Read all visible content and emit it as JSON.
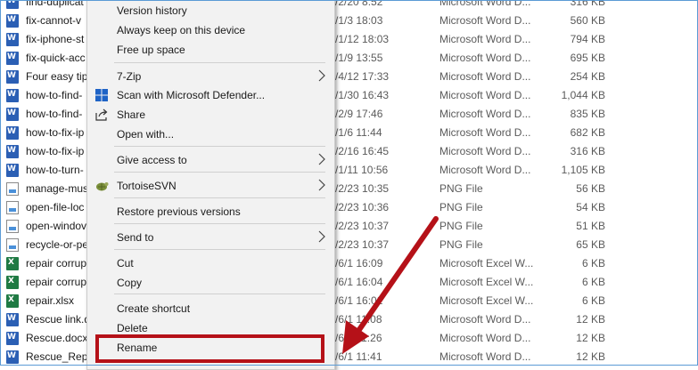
{
  "files": [
    {
      "name": "find-duplicat",
      "date": "/2/20 8:52",
      "type": "Microsoft Word D...",
      "size": "316 KB",
      "kind": "word"
    },
    {
      "name": "fix-cannot-v",
      "date": "/1/3 18:03",
      "type": "Microsoft Word D...",
      "size": "560 KB",
      "kind": "word"
    },
    {
      "name": "fix-iphone-st",
      "date": "/1/12 18:03",
      "type": "Microsoft Word D...",
      "size": "794 KB",
      "kind": "word"
    },
    {
      "name": "fix-quick-acc",
      "date": "/1/9 13:55",
      "type": "Microsoft Word D...",
      "size": "695 KB",
      "kind": "word"
    },
    {
      "name": "Four easy  tip",
      "date": "/4/12 17:33",
      "type": "Microsoft Word D...",
      "size": "254 KB",
      "kind": "word"
    },
    {
      "name": "how-to-find-",
      "date": "/1/30 16:43",
      "type": "Microsoft Word D...",
      "size": "1,044 KB",
      "kind": "word"
    },
    {
      "name": "how-to-find-",
      "date": "/2/9 17:46",
      "type": "Microsoft Word D...",
      "size": "835 KB",
      "kind": "word"
    },
    {
      "name": "how-to-fix-ip",
      "date": "/1/6 11:44",
      "type": "Microsoft Word D...",
      "size": "682 KB",
      "kind": "word"
    },
    {
      "name": "how-to-fix-ip",
      "date": "/2/16 16:45",
      "type": "Microsoft Word D...",
      "size": "316 KB",
      "kind": "word"
    },
    {
      "name": "how-to-turn-",
      "date": "/1/11 10:56",
      "type": "Microsoft Word D...",
      "size": "1,105 KB",
      "kind": "word"
    },
    {
      "name": "manage-mus",
      "date": "/2/23 10:35",
      "type": "PNG File",
      "size": "56 KB",
      "kind": "png"
    },
    {
      "name": "open-file-loc",
      "date": "/2/23 10:36",
      "type": "PNG File",
      "size": "54 KB",
      "kind": "png"
    },
    {
      "name": "open-windov",
      "date": "/2/23 10:37",
      "type": "PNG File",
      "size": "51 KB",
      "kind": "png"
    },
    {
      "name": "recycle-or-pe",
      "date": "/2/23 10:37",
      "type": "PNG File",
      "size": "65 KB",
      "kind": "png"
    },
    {
      "name": "repair corrup",
      "date": "/6/1 16:09",
      "type": "Microsoft Excel W...",
      "size": "6 KB",
      "kind": "excel"
    },
    {
      "name": "repair corrup",
      "date": "/6/1 16:04",
      "type": "Microsoft Excel W...",
      "size": "6 KB",
      "kind": "excel"
    },
    {
      "name": "repair.xlsx",
      "date": "/6/1 16:02",
      "type": "Microsoft Excel W...",
      "size": "6 KB",
      "kind": "excel"
    },
    {
      "name": "Rescue link.d",
      "date": "/6/1 11:08",
      "type": "Microsoft Word D...",
      "size": "12 KB",
      "kind": "word"
    },
    {
      "name": "Rescue.docx",
      "date": "/6/1 11:26",
      "type": "Microsoft Word D...",
      "size": "12 KB",
      "kind": "word"
    },
    {
      "name": "Rescue_Repa",
      "date": "/6/1 11:41",
      "type": "Microsoft Word D...",
      "size": "12 KB",
      "kind": "word"
    }
  ],
  "menu": {
    "version_history": "Version history",
    "always_keep": "Always keep on this device",
    "free_up": "Free up space",
    "zip": "7-Zip",
    "defender": "Scan with Microsoft Defender...",
    "share": "Share",
    "open_with": "Open with...",
    "give_access": "Give access to",
    "tortoise": "TortoiseSVN",
    "restore": "Restore previous versions",
    "send_to": "Send to",
    "cut": "Cut",
    "copy": "Copy",
    "create_shortcut": "Create shortcut",
    "delete": "Delete",
    "rename": "Rename"
  },
  "colors": {
    "highlight": "#b51118",
    "arrow": "#b51118"
  }
}
